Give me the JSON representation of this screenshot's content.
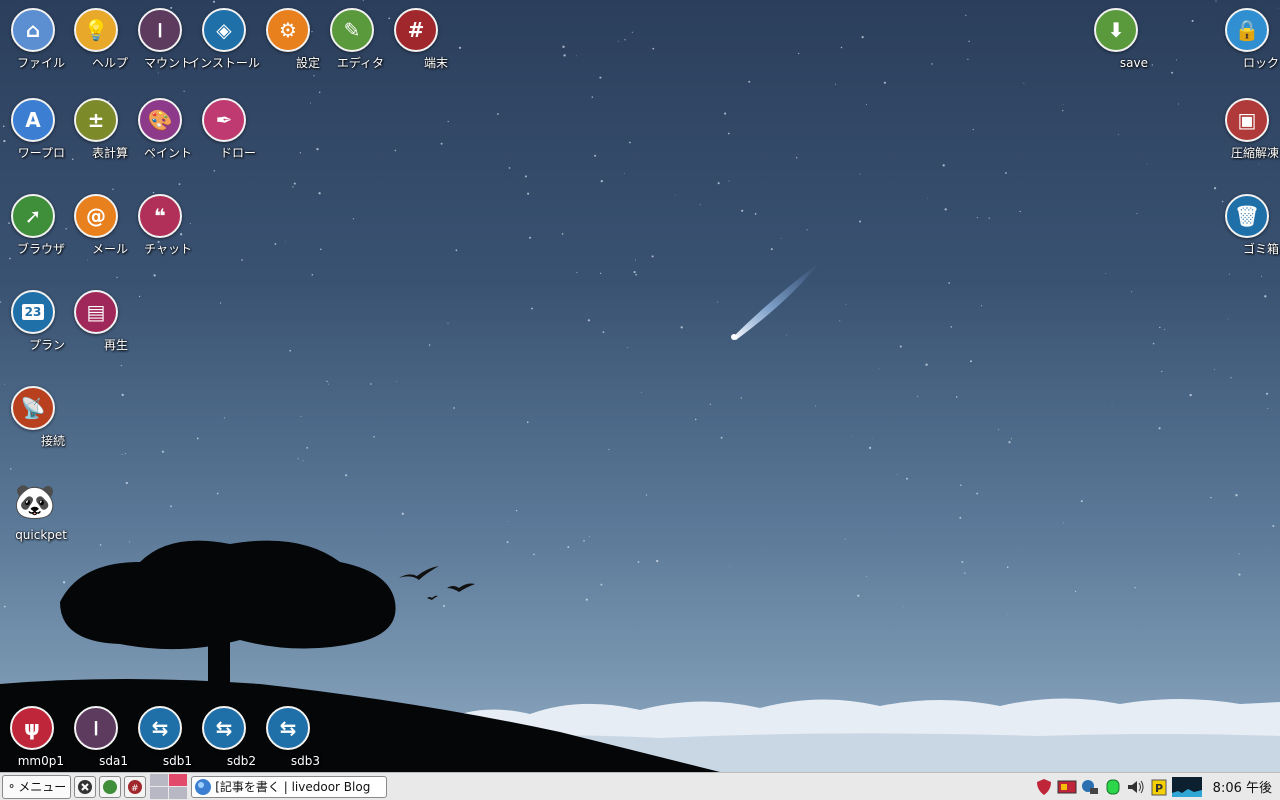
{
  "desktop": {
    "icons_left": [
      {
        "label": "ファイル",
        "icon": "home-folder-icon",
        "color": "#5b8fd1"
      },
      {
        "label": "ヘルプ",
        "icon": "lightbulb-icon",
        "color": "#e8a82a"
      },
      {
        "label": "マウント",
        "icon": "toggle-icon",
        "color": "#5c3b5e"
      },
      {
        "label": "インストール",
        "icon": "dropbox-icon",
        "color": "#1f6fa8"
      },
      {
        "label": "設定",
        "icon": "gear-icon",
        "color": "#e8801e"
      },
      {
        "label": "エディタ",
        "icon": "notepad-icon",
        "color": "#5a9a3c"
      },
      {
        "label": "端末",
        "icon": "terminal-hash-icon",
        "color": "#a0272c"
      },
      {
        "label": "ワープロ",
        "icon": "writer-icon",
        "color": "#3c7ed1"
      },
      {
        "label": "表計算",
        "icon": "spreadsheet-icon",
        "color": "#7c8a2a"
      },
      {
        "label": "ペイント",
        "icon": "palette-icon",
        "color": "#8e3a8a"
      },
      {
        "label": "ドロー",
        "icon": "draw-icon",
        "color": "#c03a72"
      },
      {
        "label": "ブラウザ",
        "icon": "compass-icon",
        "color": "#3f8f3a"
      },
      {
        "label": "メール",
        "icon": "at-mail-icon",
        "color": "#e8801e"
      },
      {
        "label": "チャット",
        "icon": "chat-icon",
        "color": "#b0305a"
      },
      {
        "label": "プラン",
        "icon": "calendar-icon",
        "color": "#1f6fa8"
      },
      {
        "label": "再生",
        "icon": "clapper-icon",
        "color": "#a0275a"
      },
      {
        "label": "接続",
        "icon": "satellite-icon",
        "color": "#b8401e"
      },
      {
        "label": "quickpet",
        "icon": "panda-icon",
        "color": "#ffffff"
      }
    ],
    "calendar_day": "23",
    "icons_right": [
      {
        "label": "save",
        "icon": "download-icon",
        "color": "#5a9a3c"
      },
      {
        "label": "ロック",
        "icon": "lock-icon",
        "color": "#2f8fd1"
      },
      {
        "label": "圧縮解凍",
        "icon": "archive-icon",
        "color": "#b03a3a"
      },
      {
        "label": "ゴミ箱",
        "icon": "trash-icon",
        "color": "#1f6fa8"
      }
    ],
    "drives": [
      {
        "label": "mm0p1",
        "icon": "usb-stick-icon",
        "color": "#c0263a"
      },
      {
        "label": "sda1",
        "icon": "toggle-icon",
        "color": "#5c3b5e"
      },
      {
        "label": "sdb1",
        "icon": "usb-icon",
        "color": "#1f6fa8"
      },
      {
        "label": "sdb2",
        "icon": "usb-icon",
        "color": "#1f6fa8"
      },
      {
        "label": "sdb3",
        "icon": "usb-icon",
        "color": "#1f6fa8"
      }
    ]
  },
  "taskbar": {
    "menu_label": "メニュー",
    "task_title": "[記事を書く | livedoor Blog",
    "clock": "8:06 午後"
  }
}
